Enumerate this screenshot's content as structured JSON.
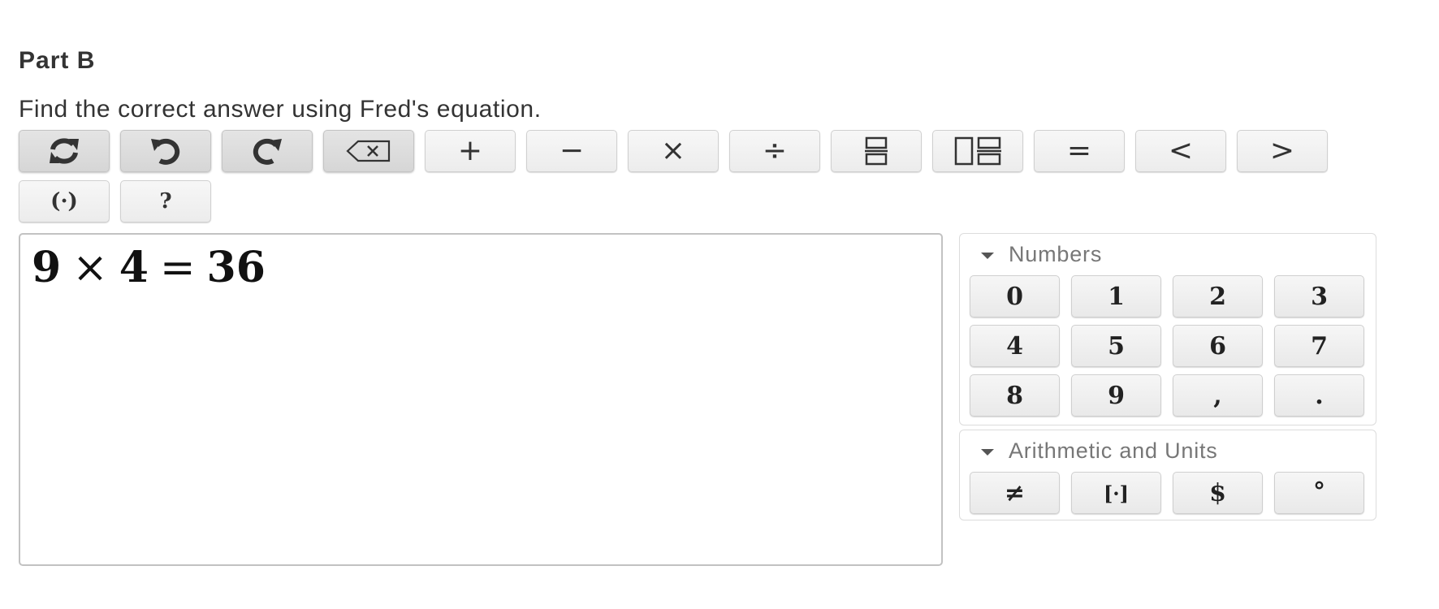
{
  "part": {
    "title": "Part B",
    "prompt": "Find the correct answer using Fred's equation."
  },
  "toolbar": {
    "row1": [
      {
        "name": "reset-button",
        "icon": "refresh-icon",
        "label": "",
        "style": "dark"
      },
      {
        "name": "undo-button",
        "icon": "undo-icon",
        "label": "",
        "style": "dark"
      },
      {
        "name": "redo-button",
        "icon": "redo-icon",
        "label": "",
        "style": "dark"
      },
      {
        "name": "backspace-button",
        "icon": "backspace-icon",
        "label": "",
        "style": "dark"
      },
      {
        "name": "plus-button",
        "icon": "plus-icon",
        "label": "+",
        "style": "light"
      },
      {
        "name": "minus-button",
        "icon": "minus-icon",
        "label": "−",
        "style": "light"
      },
      {
        "name": "times-button",
        "icon": "times-icon",
        "label": "×",
        "style": "light"
      },
      {
        "name": "divide-button",
        "icon": "divide-icon",
        "label": "÷",
        "style": "light"
      },
      {
        "name": "fraction-button",
        "icon": "fraction-icon",
        "label": "",
        "style": "light"
      },
      {
        "name": "mixed-number-button",
        "icon": "mixed-number-icon",
        "label": "",
        "style": "light"
      },
      {
        "name": "equals-button",
        "icon": "equals-icon",
        "label": "=",
        "style": "light"
      },
      {
        "name": "less-than-button",
        "icon": "less-than-icon",
        "label": "<",
        "style": "light"
      },
      {
        "name": "greater-than-button",
        "icon": "greater-than-icon",
        "label": ">",
        "style": "light"
      }
    ],
    "row2": [
      {
        "name": "parentheses-button",
        "icon": "parentheses-icon",
        "label": "(·)",
        "style": "light"
      },
      {
        "name": "help-button",
        "icon": "help-icon",
        "label": "?",
        "style": "light"
      }
    ]
  },
  "editor": {
    "expression": {
      "left": "9",
      "op1": "×",
      "right": "4",
      "op2": "=",
      "result": "36"
    }
  },
  "keypad": {
    "numbers": {
      "title": "Numbers",
      "keys": [
        "0",
        "1",
        "2",
        "3",
        "4",
        "5",
        "6",
        "7",
        "8",
        "9",
        ",",
        "."
      ]
    },
    "arithmetic": {
      "title": "Arithmetic and Units",
      "keys": [
        "≠",
        "[·]",
        "$",
        "°"
      ]
    }
  }
}
